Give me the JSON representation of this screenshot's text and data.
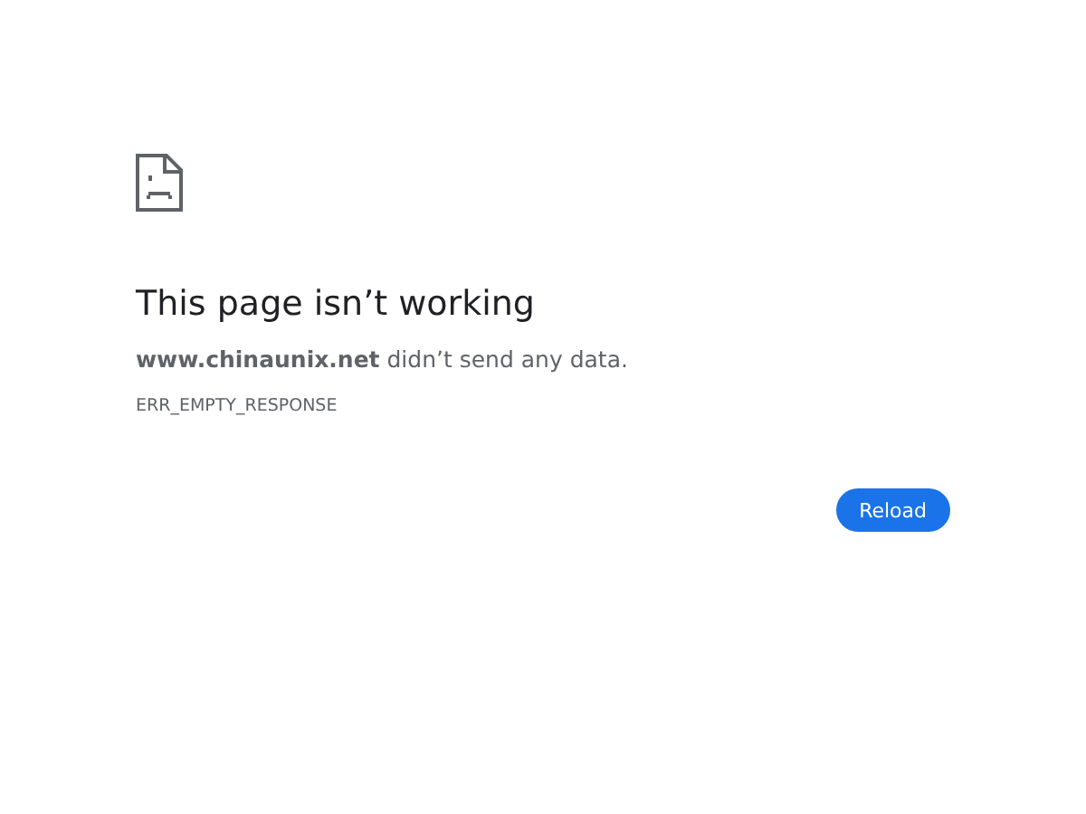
{
  "title": "This page isn’t working",
  "message": "**www.chinaunix.net** didn’t send any data.",
  "error_code": "ERR_EMPTY_RESPONSE",
  "buttons": [
    "Reload"
  ]
}
